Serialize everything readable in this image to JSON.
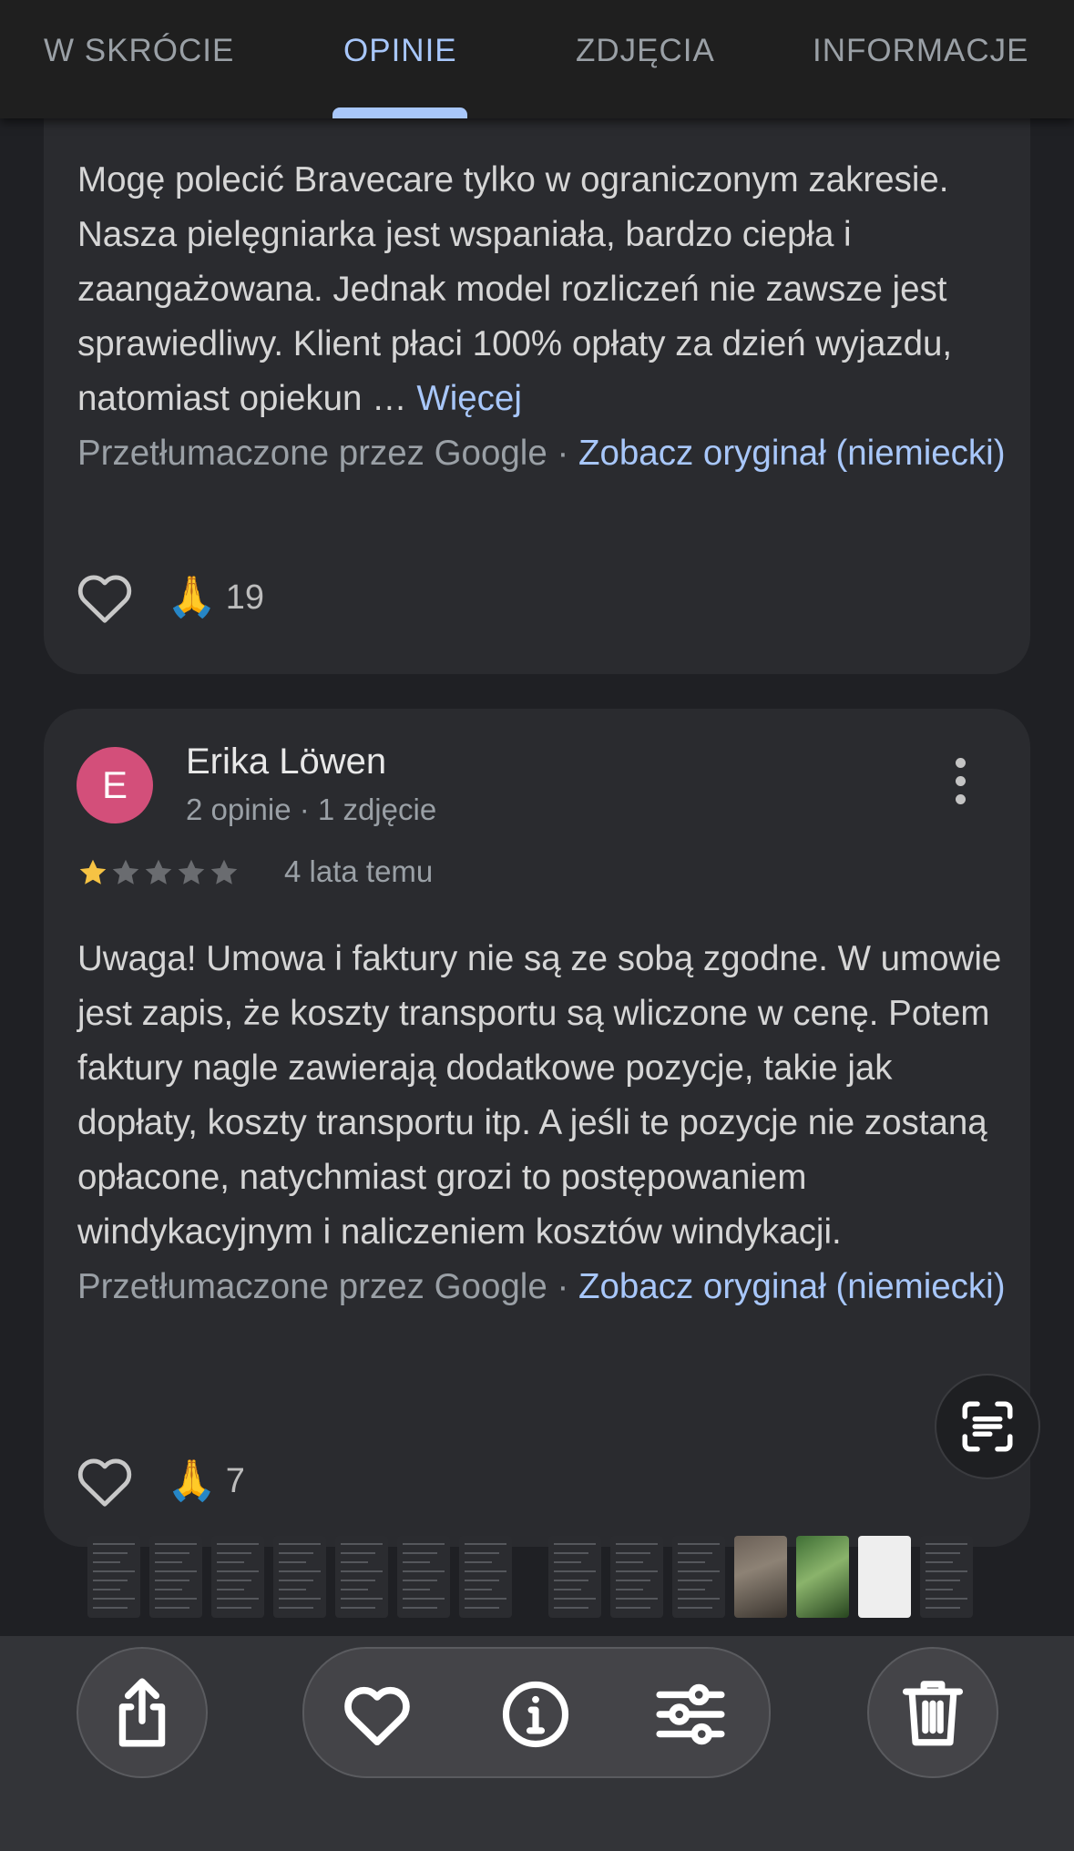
{
  "tabs": [
    {
      "label": "W SKRÓCIE"
    },
    {
      "label": "OPINIE"
    },
    {
      "label": "ZDJĘCIA"
    },
    {
      "label": "INFORMACJE"
    }
  ],
  "active_tab": "OPINIE",
  "reviews": [
    {
      "text": "Mogę polecić Bravecare tylko w ograniczonym zakresie. Nasza pielęgniarka jest wspaniała, bardzo ciepła i zaangażowana. Jednak model rozliczeń nie zawsze jest sprawiedliwy. Klient płaci 100% opłaty za dzień wyjazdu, natomiast opiekun …",
      "more_label": "Więcej",
      "translated_label": "Przetłumaczone przez Google",
      "separator": "·",
      "original_link": "Zobacz oryginał (niemiecki)",
      "reaction_emoji": "🙏",
      "reaction_count": "19"
    },
    {
      "author": "Erika Löwen",
      "avatar_letter": "E",
      "meta": "2 opinie · 1 zdjęcie",
      "rating": 1,
      "rating_max": 5,
      "time": "4 lata temu",
      "text": "Uwaga! Umowa i faktury nie są ze sobą zgodne. W umowie jest zapis, że koszty transportu są wliczone w cenę. Potem faktury nagle zawierają dodatkowe pozycje, takie jak dopłaty, koszty transportu itp. A jeśli te pozycje nie zostaną opłacone, natychmiast grozi to postępowaniem windykacyjnym i naliczeniem kosztów windykacji.",
      "translated_label": "Przetłumaczone przez Google",
      "separator": "·",
      "original_link": "Zobacz oryginał (niemiecki)",
      "reaction_emoji": "🙏",
      "reaction_count": "7"
    }
  ],
  "colors": {
    "accent": "#a8c7fa",
    "card": "#2a2b2f",
    "background": "#1f2024",
    "avatar": "#d34f7a",
    "star_filled": "#f6c344",
    "star_empty": "#6a6c70"
  },
  "bottom_bar": {
    "buttons": [
      "share-icon",
      "heart-icon",
      "info-icon",
      "adjust-icon",
      "trash-icon"
    ]
  }
}
